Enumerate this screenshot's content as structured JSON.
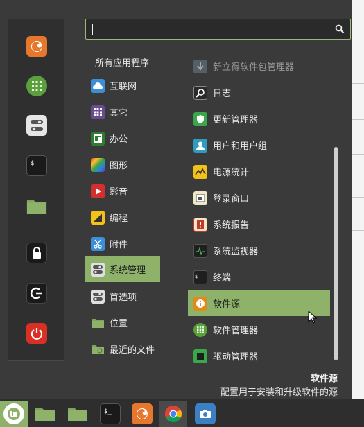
{
  "search": {
    "value": "",
    "placeholder": ""
  },
  "categories_heading": "所有应用程序",
  "categories": [
    {
      "label": "互联网",
      "icon": "cloud-icon",
      "color": "#3b8fd9"
    },
    {
      "label": "其它",
      "icon": "grid-icon",
      "color": "#6b4a8f"
    },
    {
      "label": "办公",
      "icon": "office-icon",
      "color": "#2e7d32"
    },
    {
      "label": "图形",
      "icon": "palette-icon",
      "color": "#c2185b"
    },
    {
      "label": "影音",
      "icon": "play-icon",
      "color": "#d32f2f"
    },
    {
      "label": "编程",
      "icon": "ruler-icon",
      "color": "#f2c21b"
    },
    {
      "label": "附件",
      "icon": "scissors-icon",
      "color": "#3b8fd9"
    },
    {
      "label": "系统管理",
      "icon": "toggles-icon",
      "color": "#e0e0e0",
      "selected": true
    },
    {
      "label": "首选项",
      "icon": "toggles-icon",
      "color": "#e0e0e0"
    },
    {
      "label": "位置",
      "icon": "folder-icon",
      "color": "#8fb26a"
    },
    {
      "label": "最近的文件",
      "icon": "recent-folder-icon",
      "color": "#8fb26a"
    }
  ],
  "apps": [
    {
      "label": "新立得软件包管理器",
      "icon": "download-icon",
      "color": "#6a7f8f",
      "dim": true
    },
    {
      "label": "日志",
      "icon": "magnifier-icon",
      "color": "#2a2a2a"
    },
    {
      "label": "更新管理器",
      "icon": "shield-icon",
      "color": "#3aa84a"
    },
    {
      "label": "用户和用户组",
      "icon": "user-icon",
      "color": "#2e9bbf"
    },
    {
      "label": "电源统计",
      "icon": "power-graph-icon",
      "color": "#f2c21b"
    },
    {
      "label": "登录窗口",
      "icon": "login-window-icon",
      "color": "#f0e6c8"
    },
    {
      "label": "系统报告",
      "icon": "warning-report-icon",
      "color": "#c0392b"
    },
    {
      "label": "系统监视器",
      "icon": "monitor-graph-icon",
      "color": "#1f1f1f"
    },
    {
      "label": "终端",
      "icon": "terminal-icon",
      "color": "#1f1f1f"
    },
    {
      "label": "软件源",
      "icon": "info-icon",
      "color": "#e08a1a",
      "selected": true
    },
    {
      "label": "软件管理器",
      "icon": "apps-grid-icon",
      "color": "#5aa03c"
    },
    {
      "label": "驱动管理器",
      "icon": "chip-icon",
      "color": "#3aa84a"
    }
  ],
  "description": {
    "title": "软件源",
    "text": "配置用于安装和升级软件的源"
  },
  "favorites": [
    {
      "name": "firefox-icon",
      "color": "#e8772e"
    },
    {
      "name": "software-manager-icon",
      "color": "#5aa03c"
    },
    {
      "name": "settings-toggles-icon",
      "color": "#e6e6e6"
    },
    {
      "name": "terminal-icon",
      "color": "#1a1a1a"
    },
    {
      "name": "folder-icon",
      "color": "#8fb26a"
    },
    {
      "name": "lock-icon",
      "color": "#1a1a1a"
    },
    {
      "name": "logout-icon",
      "color": "#1a1a1a"
    },
    {
      "name": "power-icon",
      "color": "#d93025"
    }
  ],
  "taskbar": [
    {
      "name": "mint-menu-icon"
    },
    {
      "name": "folder-icon"
    },
    {
      "name": "folder-icon"
    },
    {
      "name": "terminal-icon"
    },
    {
      "name": "firefox-icon"
    },
    {
      "name": "chrome-icon"
    },
    {
      "name": "screenshot-icon"
    }
  ],
  "colors": {
    "accent": "#8fb26a",
    "panel": "#3a3a3a",
    "dark": "#2f2f2f"
  }
}
